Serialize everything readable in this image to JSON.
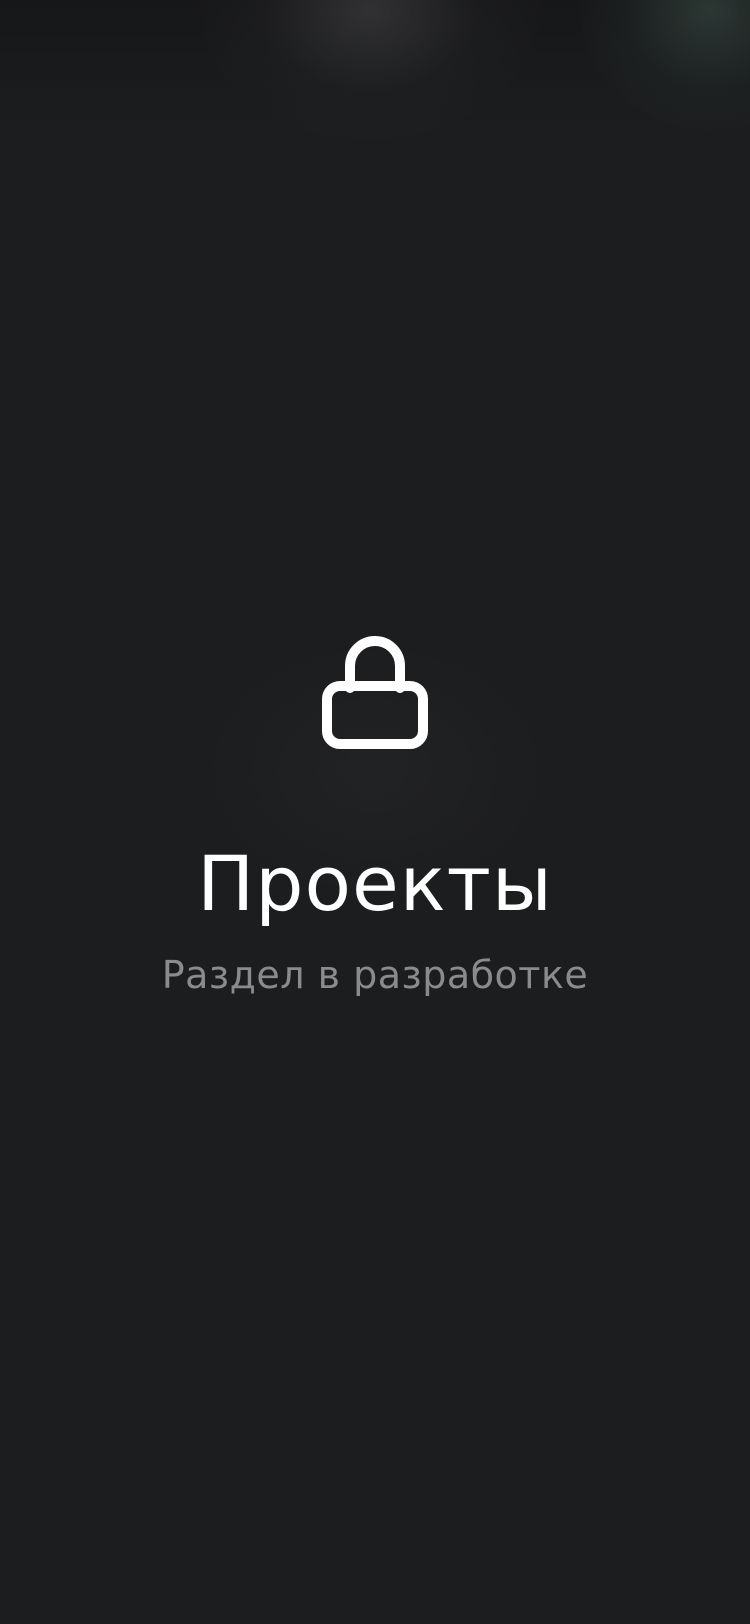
{
  "screen": {
    "lock_icon": "lock-icon",
    "title": "Проекты",
    "subtitle": "Раздел в разработке"
  },
  "colors": {
    "background": "#1c1d1f",
    "title": "#ffffff",
    "subtitle": "#8a8b8d",
    "icon": "#ffffff"
  }
}
